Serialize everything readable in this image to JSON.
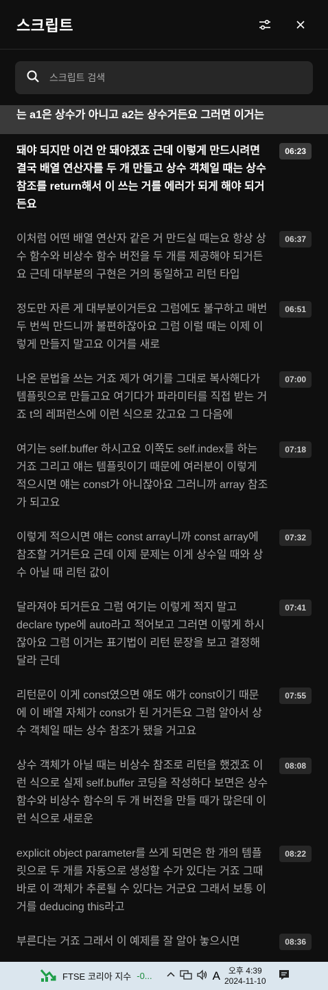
{
  "header": {
    "title": "스크립트",
    "filter_icon": "sliders-icon",
    "close_icon": "close-icon"
  },
  "search": {
    "placeholder": "스크립트 검색",
    "value": "",
    "icon": "search-icon"
  },
  "partial_segment": {
    "text": "는 a1은 상수가 아니고 a2는 상수거든요 그러면 이거는"
  },
  "segments": [
    {
      "time": "06:23",
      "text": "돼야 되지만 이건 안 돼야겠죠 근데 이렇게 만드시려면 결국 배열 연산자를 두 개 만들고 상수 객체일 때는 상수 참조를 return해서 이 쓰는 거를 에러가 되게 해야 되거든요",
      "active": true
    },
    {
      "time": "06:37",
      "text": "이처럼 어떤 배열 연산자 같은 거 만드실 때는요 항상 상수 함수와 비상수 함수 버전을 두 개를 제공해야 되거든요 근데 대부분의 구현은 거의 동일하고 리턴 타입"
    },
    {
      "time": "06:51",
      "text": "정도만 자른 게 대부분이거든요 그럼에도 불구하고 매번 두 번씩 만드니까 불편하잖아요 그럼 이럴 때는 이제 이렇게 만들지 말고요 이거를 새로"
    },
    {
      "time": "07:00",
      "text": "나온 문법을 쓰는 거죠 제가 여기를 그대로 복사해다가 템플릿으로 만들고요 여기다가 파라미터를 직접 받는 거죠 t의 레퍼런스에 이런 식으로 갔고요 그 다음에"
    },
    {
      "time": "07:18",
      "text": "여기는 self.buffer 하시고요 이쪽도 self.index를 하는 거죠 그리고 얘는 템플릿이기 때문에 여러분이 이렇게 적으시면 얘는 const가 아니잖아요 그러니까 array 참조가 되고요"
    },
    {
      "time": "07:32",
      "text": "이렇게 적으시면 얘는 const array니까 const array에 참조할 거거든요 근데 이제 문제는 이게 상수일 때와 상수 아닐 때 리턴 값이"
    },
    {
      "time": "07:41",
      "text": "달라져야 되거든요 그럼 여기는 이렇게 적지 말고 declare type에 auto라고 적어보고 그러면 이렇게 하시잖아요 그럼 이거는 표기법이 리턴 문장을 보고 결정해 달라 근데"
    },
    {
      "time": "07:55",
      "text": "리턴문이 이게 const였으면 얘도 얘가 const이기 때문에 이 배열 자체가 const가 된 거거든요 그럼 알아서 상수 객체일 때는 상수 참조가 됐을 거고요"
    },
    {
      "time": "08:08",
      "text": "상수 객체가 아닐 때는 비상수 참조로 리턴을 했겠죠 이런 식으로 실제 self.buffer 코딩을 작성하다 보면은 상수 함수와 비상수 함수의 두 개 버전을 만들 때가 많은데 이런 식으로 새로운"
    },
    {
      "time": "08:22",
      "text": "explicit object parameter를 쓰게 되면은 한 개의 템플릿으로 두 개를 자동으로 생성할 수가 있다는 거죠 그때 바로 이 객체가 추론될 수 있다는 거군요 그래서 보통 이거를 deducing this라고"
    },
    {
      "time": "08:36",
      "text": "부른다는 거죠 그래서 이 예제를 잘 알아 놓으시면"
    }
  ],
  "taskbar": {
    "stock_name": "FTSE 코리아 지수",
    "stock_change": "-0...",
    "ime": "A",
    "time": "오후 4:39",
    "date": "2024-11-10"
  }
}
